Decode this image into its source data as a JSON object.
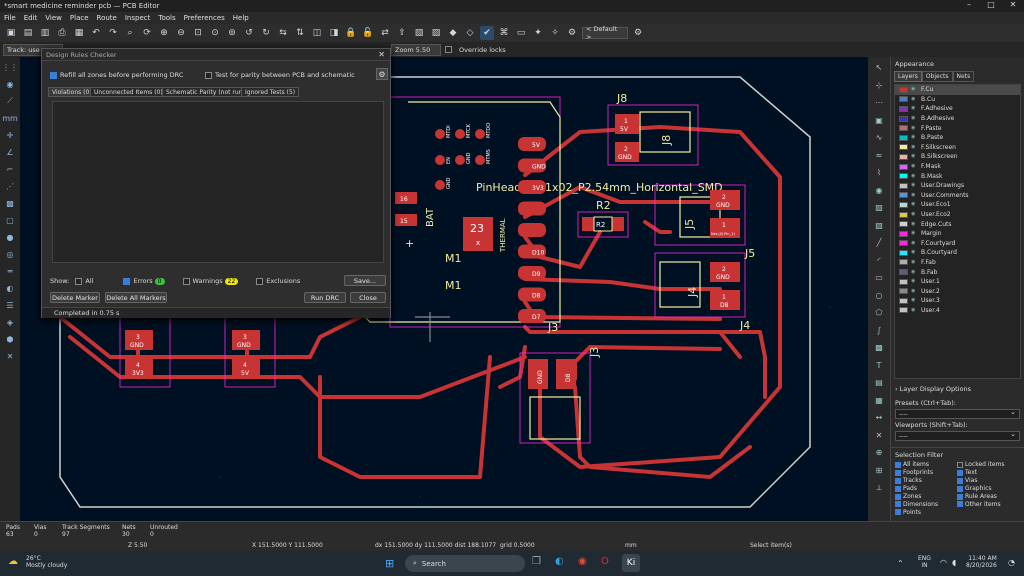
{
  "window": {
    "title": "*smart medicine reminder pcb — PCB Editor"
  },
  "menu": [
    "File",
    "Edit",
    "View",
    "Place",
    "Route",
    "Inspect",
    "Tools",
    "Preferences",
    "Help"
  ],
  "toolbar": {
    "default_select": "< Default >",
    "track_select": "Track: use ne",
    "zoom_select": "Zoom 5.50",
    "override_locks": "Override locks"
  },
  "drc": {
    "title": "Design Rules Checker",
    "refill_label": "Refill all zones before performing DRC",
    "parity_label": "Test for parity between PCB and schematic",
    "tabs": [
      "Violations (0)",
      "Unconnected Items (0)",
      "Schematic Parity (not run)",
      "Ignored Tests (5)"
    ],
    "show_label": "Show:",
    "filters": {
      "all": "All",
      "errors": "Errors",
      "errors_count": "0",
      "warnings": "Warnings",
      "warnings_count": "22",
      "exclusions": "Exclusions"
    },
    "save_btn": "Save...",
    "delete_marker": "Delete Marker",
    "delete_all": "Delete All Markers",
    "run_drc": "Run DRC",
    "close": "Close",
    "status": "Completed in 0.75 s"
  },
  "appearance": {
    "title": "Appearance",
    "tabs": [
      "Layers",
      "Objects",
      "Nets"
    ],
    "layers": [
      {
        "name": "F.Cu",
        "color": "#c83434"
      },
      {
        "name": "B.Cu",
        "color": "#4d7fc4"
      },
      {
        "name": "F.Adhesive",
        "color": "#8434b0"
      },
      {
        "name": "B.Adhesive",
        "color": "#3838a8"
      },
      {
        "name": "F.Paste",
        "color": "#b47070"
      },
      {
        "name": "B.Paste",
        "color": "#00c2c2"
      },
      {
        "name": "F.Silkscreen",
        "color": "#f2eda1"
      },
      {
        "name": "B.Silkscreen",
        "color": "#e8b2a7"
      },
      {
        "name": "F.Mask",
        "color": "#d864ff"
      },
      {
        "name": "B.Mask",
        "color": "#02ffee"
      },
      {
        "name": "User.Drawings",
        "color": "#c2c2c2"
      },
      {
        "name": "User.Comments",
        "color": "#5994dc"
      },
      {
        "name": "User.Eco1",
        "color": "#b4dbd2"
      },
      {
        "name": "User.Eco2",
        "color": "#d8c852"
      },
      {
        "name": "Edge.Cuts",
        "color": "#d0d2cd"
      },
      {
        "name": "Margin",
        "color": "#ff26e2"
      },
      {
        "name": "F.Courtyard",
        "color": "#ff26e2"
      },
      {
        "name": "B.Courtyard",
        "color": "#26e9ff"
      },
      {
        "name": "F.Fab",
        "color": "#afafaf"
      },
      {
        "name": "B.Fab",
        "color": "#585d84"
      },
      {
        "name": "User.1",
        "color": "#c2c2c2"
      },
      {
        "name": "User.2",
        "color": "#898989"
      },
      {
        "name": "User.3",
        "color": "#c2c2c2"
      },
      {
        "name": "User.4",
        "color": "#c2c2c2"
      }
    ],
    "layer_display_options": "Layer Display Options",
    "presets_label": "Presets (Ctrl+Tab):",
    "presets_value": "----",
    "viewports_label": "Viewports (Shift+Tab):",
    "viewports_value": "----",
    "selection_filter": "Selection Filter",
    "filters_left": [
      "All items",
      "Footprints",
      "Tracks",
      "Pads",
      "Zones",
      "Dimensions",
      "Points"
    ],
    "filters_right": [
      "Locked items",
      "Text",
      "Vias",
      "Graphics",
      "Rule Areas",
      "Other items"
    ]
  },
  "board": {
    "refs": {
      "j8": "J8",
      "j5": "J5",
      "j4": "J4",
      "j3": "J3",
      "m1a": "M1",
      "m1b": "M1",
      "r2": "R2",
      "r2pad": "R2"
    },
    "silk_text": "PinHeader_01x02_P2.54mm_Horizontal_SMD",
    "bat": "BAT",
    "thermal": "THERMAL",
    "pad23": "23",
    "padx": "x",
    "j8_pads": [
      {
        "n": "1",
        "t": "5V"
      },
      {
        "n": "2",
        "t": "GND"
      }
    ],
    "j5_pads": [
      {
        "n": "2",
        "t": "GND"
      },
      {
        "n": "1",
        "t": "Net-(J5-Pin_1)"
      }
    ],
    "j4_pads": [
      {
        "n": "2",
        "t": "GND"
      },
      {
        "n": "1",
        "t": "D8"
      }
    ],
    "j3_pads": [
      {
        "n": "",
        "t": "GND"
      },
      {
        "n": "",
        "t": "D8"
      }
    ],
    "bl_pads": [
      {
        "n": "3",
        "t": "GND"
      },
      {
        "n": "4",
        "t": "3V3"
      },
      {
        "n": "3",
        "t": "GND"
      },
      {
        "n": "4",
        "t": "5V"
      }
    ],
    "left_pads": [
      "16",
      "15"
    ],
    "col_pads": [
      "5V",
      "GND",
      "3V3",
      "",
      "",
      "D10",
      "D9",
      "D8",
      "D7"
    ],
    "pin_labels": [
      "MTDI",
      "MTCK",
      "MTDO",
      "EN",
      "GND",
      "MTMS",
      "GND"
    ]
  },
  "status": {
    "pads_label": "Pads",
    "pads_val": "63",
    "vias_label": "Vias",
    "vias_val": "0",
    "tracks_label": "Track Segments",
    "tracks_val": "97",
    "nets_label": "Nets",
    "nets_val": "30",
    "unrouted_label": "Unrouted",
    "unrouted_val": "0",
    "zoom": "Z 5.50",
    "xy": "X 151.5000  Y 111.5000",
    "dxy": "dx 151.5000  dy 111.5000  dist 188.1077",
    "grid": "grid 0.5000",
    "units": "mm",
    "select": "Select item(s)"
  },
  "taskbar": {
    "weather_temp": "26°C",
    "weather_desc": "Mostly cloudy",
    "search": "Search",
    "lang1": "ENG",
    "lang2": "IN",
    "time": "11:40 AM",
    "date": "8/20/2026"
  }
}
